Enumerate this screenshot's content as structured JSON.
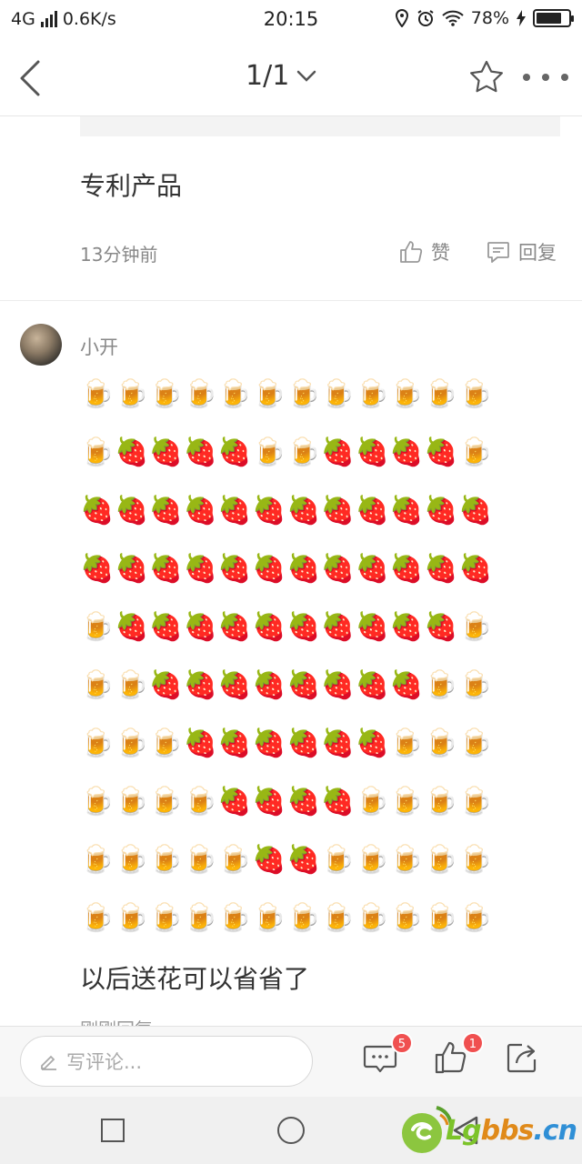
{
  "status_bar": {
    "network": "4G",
    "speed": "0.6K/s",
    "time": "20:15",
    "battery": "78%",
    "battery_level": 0.78
  },
  "nav": {
    "page_indicator": "1/1",
    "back_icon": "back-arrow-icon",
    "star_icon": "star-icon",
    "more_icon": "more-dots-icon"
  },
  "comment1": {
    "text": "专利产品",
    "time": "13分钟前",
    "like_label": "赞",
    "reply_label": "回复"
  },
  "comment2": {
    "username": "小开",
    "emoji_rows": [
      [
        "🍺",
        "🍺",
        "🍺",
        "🍺",
        "🍺",
        "🍺",
        "🍺",
        "🍺",
        "🍺",
        "🍺",
        "🍺",
        "🍺"
      ],
      [
        "🍺",
        "🍓",
        "🍓",
        "🍓",
        "🍓",
        "🍺",
        "🍺",
        "🍓",
        "🍓",
        "🍓",
        "🍓",
        "🍺"
      ],
      [
        "🍓",
        "🍓",
        "🍓",
        "🍓",
        "🍓",
        "🍓",
        "🍓",
        "🍓",
        "🍓",
        "🍓",
        "🍓",
        "🍓"
      ],
      [
        "🍓",
        "🍓",
        "🍓",
        "🍓",
        "🍓",
        "🍓",
        "🍓",
        "🍓",
        "🍓",
        "🍓",
        "🍓",
        "🍓"
      ],
      [
        "🍺",
        "🍓",
        "🍓",
        "🍓",
        "🍓",
        "🍓",
        "🍓",
        "🍓",
        "🍓",
        "🍓",
        "🍓",
        "🍺"
      ],
      [
        "🍺",
        "🍺",
        "🍓",
        "🍓",
        "🍓",
        "🍓",
        "🍓",
        "🍓",
        "🍓",
        "🍓",
        "🍺",
        "🍺"
      ],
      [
        "🍺",
        "🍺",
        "🍺",
        "🍓",
        "🍓",
        "🍓",
        "🍓",
        "🍓",
        "🍓",
        "🍺",
        "🍺",
        "🍺"
      ],
      [
        "🍺",
        "🍺",
        "🍺",
        "🍺",
        "🍓",
        "🍓",
        "🍓",
        "🍓",
        "🍺",
        "🍺",
        "🍺",
        "🍺"
      ],
      [
        "🍺",
        "🍺",
        "🍺",
        "🍺",
        "🍺",
        "🍓",
        "🍓",
        "🍺",
        "🍺",
        "🍺",
        "🍺",
        "🍺"
      ],
      [
        "🍺",
        "🍺",
        "🍺",
        "🍺",
        "🍺",
        "🍺",
        "🍺",
        "🍺",
        "🍺",
        "🍺",
        "🍺",
        "🍺"
      ]
    ],
    "text": "以后送花可以省省了",
    "time": "刚刚回复"
  },
  "bottom_bar": {
    "input_placeholder": "写评论...",
    "comment_count": "5",
    "like_count": "1"
  },
  "watermark": {
    "lg": "Lg",
    "bbs": "bbs",
    "cn": ".cn"
  },
  "colors": {
    "badge": "#f05050",
    "text_primary": "#333333",
    "text_secondary": "#888888"
  }
}
